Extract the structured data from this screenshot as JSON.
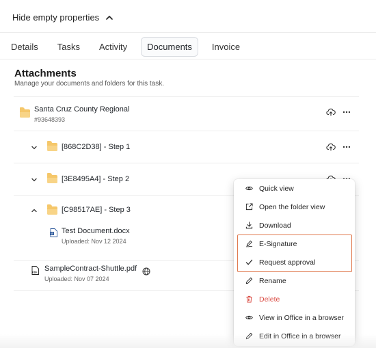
{
  "header": {
    "hide_empty_label": "Hide empty properties"
  },
  "tabs": [
    {
      "label": "Details"
    },
    {
      "label": "Tasks"
    },
    {
      "label": "Activity"
    },
    {
      "label": "Documents",
      "active": true
    },
    {
      "label": "Invoice"
    }
  ],
  "attachments": {
    "title": "Attachments",
    "subtitle": "Manage your documents and folders for this task."
  },
  "items": [
    {
      "type": "folder",
      "name": "Santa Cruz County Regional",
      "sub": "#93648393"
    },
    {
      "type": "folder",
      "name": "[868C2D38] - Step 1",
      "expanded": false
    },
    {
      "type": "folder",
      "name": "[3E8495A4] - Step 2",
      "expanded": false
    },
    {
      "type": "folder",
      "name": "[C98517AE] - Step 3",
      "expanded": true,
      "child": {
        "type": "docx",
        "name": "Test Document.docx",
        "sub": "Uploaded: Nov 12 2024"
      }
    },
    {
      "type": "pdf",
      "name": "SampleContract-Shuttle.pdf",
      "sub": "Uploaded: Nov 07 2024"
    }
  ],
  "context_menu": {
    "items": [
      {
        "label": "Quick view",
        "icon": "eye-icon"
      },
      {
        "label": "Open the folder view",
        "icon": "external-link-icon"
      },
      {
        "label": "Download",
        "icon": "download-icon"
      },
      {
        "label": "E-Signature",
        "icon": "signature-icon",
        "highlighted": true
      },
      {
        "label": "Request approval",
        "icon": "check-icon",
        "highlighted": true
      },
      {
        "label": "Rename",
        "icon": "pencil-icon"
      },
      {
        "label": "Delete",
        "icon": "trash-icon",
        "danger": true
      },
      {
        "label": "View in Office in a browser",
        "icon": "eye-icon"
      },
      {
        "label": "Edit in Office in a browser",
        "icon": "pencil-icon"
      }
    ]
  },
  "colors": {
    "folder": "#f5c76a",
    "danger": "#d9463e",
    "highlight": "#e07a4f"
  }
}
